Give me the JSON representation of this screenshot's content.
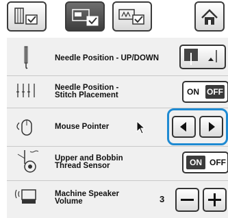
{
  "tabs": [
    {
      "id": "tab-1",
      "icon": "stitch-settings-icon",
      "active": false
    },
    {
      "id": "tab-2",
      "icon": "machine-settings-icon",
      "active": true
    },
    {
      "id": "tab-3",
      "icon": "embroidery-settings-icon",
      "active": false
    }
  ],
  "home_icon": "home-icon",
  "settings": [
    {
      "label": "Needle Position - UP/DOWN",
      "control": "needle-up-down-button"
    },
    {
      "label": "Needle Position -\nStitch Placement",
      "control": "toggle",
      "on_label": "ON",
      "off_label": "OFF",
      "state": "OFF"
    },
    {
      "label": "Mouse Pointer",
      "control": "arrows"
    },
    {
      "label": "Upper and Bobbin\nThread Sensor",
      "control": "toggle",
      "on_label": "ON",
      "off_label": "OFF",
      "state": "ON"
    },
    {
      "label": "Machine Speaker\nVolume",
      "control": "stepper",
      "value": "3"
    }
  ],
  "colors": {
    "highlight": "#1e8ad2",
    "active_tab": "#3d3d3d"
  }
}
